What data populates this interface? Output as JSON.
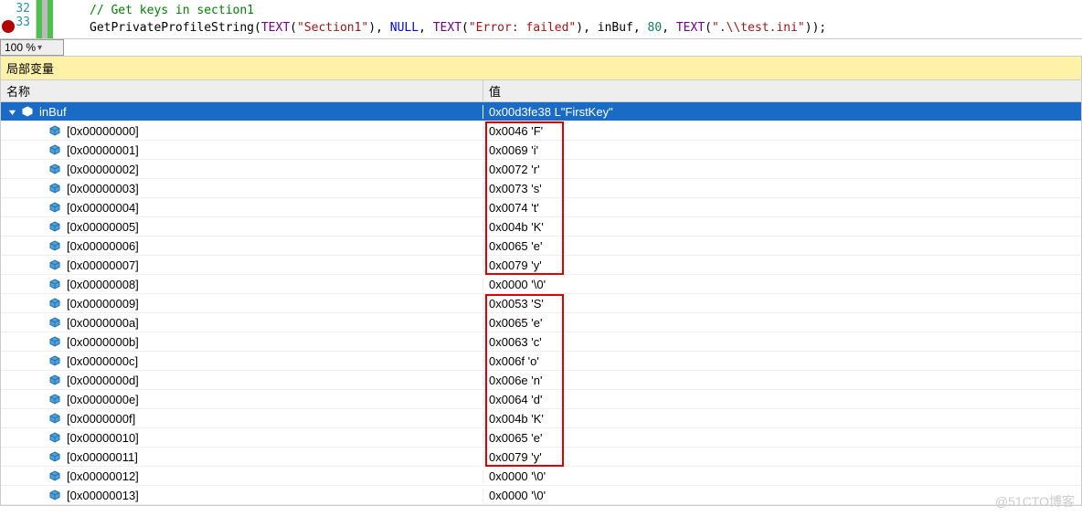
{
  "code": {
    "lines": [
      32,
      33
    ],
    "comment": "// Get keys in section1",
    "fn": "GetPrivateProfileString",
    "macro": "TEXT",
    "str1": "\"Section1\"",
    "null": "NULL",
    "str2": "\"Error: failed\"",
    "id1": "inBuf",
    "num": "80",
    "str3": "\".\\\\test.ini\""
  },
  "zoom": "100 %",
  "panel_title": "局部变量",
  "headers": {
    "name": "名称",
    "value": "值"
  },
  "root": {
    "name": "inBuf",
    "value": "0x00d3fe38 L\"FirstKey\""
  },
  "rows": [
    {
      "idx": "[0x00000000]",
      "val": "0x0046 'F'",
      "box": 1
    },
    {
      "idx": "[0x00000001]",
      "val": "0x0069 'i'",
      "box": 1
    },
    {
      "idx": "[0x00000002]",
      "val": "0x0072 'r'",
      "box": 1
    },
    {
      "idx": "[0x00000003]",
      "val": "0x0073 's'",
      "box": 1
    },
    {
      "idx": "[0x00000004]",
      "val": "0x0074 't'",
      "box": 1
    },
    {
      "idx": "[0x00000005]",
      "val": "0x004b 'K'",
      "box": 1
    },
    {
      "idx": "[0x00000006]",
      "val": "0x0065 'e'",
      "box": 1
    },
    {
      "idx": "[0x00000007]",
      "val": "0x0079 'y'",
      "box": 1
    },
    {
      "idx": "[0x00000008]",
      "val": "0x0000 '\\0'",
      "box": 0
    },
    {
      "idx": "[0x00000009]",
      "val": "0x0053 'S'",
      "box": 2
    },
    {
      "idx": "[0x0000000a]",
      "val": "0x0065 'e'",
      "box": 2
    },
    {
      "idx": "[0x0000000b]",
      "val": "0x0063 'c'",
      "box": 2
    },
    {
      "idx": "[0x0000000c]",
      "val": "0x006f 'o'",
      "box": 2
    },
    {
      "idx": "[0x0000000d]",
      "val": "0x006e 'n'",
      "box": 2
    },
    {
      "idx": "[0x0000000e]",
      "val": "0x0064 'd'",
      "box": 2
    },
    {
      "idx": "[0x0000000f]",
      "val": "0x004b 'K'",
      "box": 2
    },
    {
      "idx": "[0x00000010]",
      "val": "0x0065 'e'",
      "box": 2
    },
    {
      "idx": "[0x00000011]",
      "val": "0x0079 'y'",
      "box": 2
    },
    {
      "idx": "[0x00000012]",
      "val": "0x0000 '\\0'",
      "box": 0
    },
    {
      "idx": "[0x00000013]",
      "val": "0x0000 '\\0'",
      "box": 0
    }
  ],
  "watermark": "@51CTO博客"
}
